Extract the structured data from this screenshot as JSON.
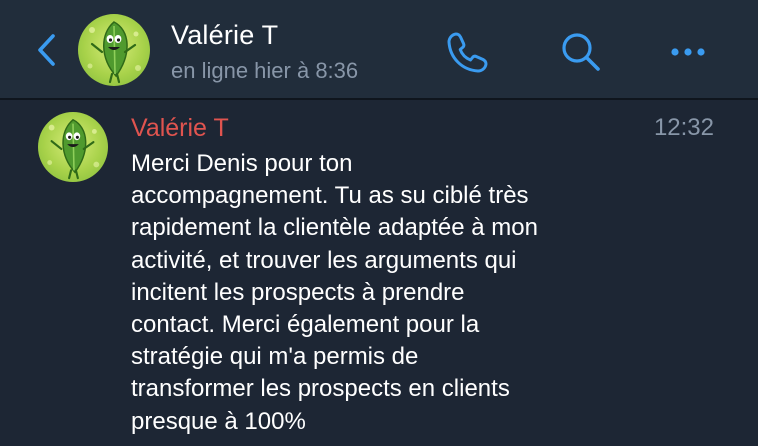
{
  "header": {
    "back_icon": "chevron-left-icon",
    "contact_name": "Valérie T",
    "status": "en ligne hier à 8:36",
    "actions": [
      "phone-icon",
      "search-icon",
      "more-icon"
    ]
  },
  "message": {
    "sender": "Valérie T",
    "time": "12:32",
    "lines": [
      "Merci Denis pour ton",
      "accompagnement. Tu as su ciblé très",
      "rapidement la clientèle adaptée à mon",
      "activité, et trouver les arguments qui",
      "incitent les prospects à prendre",
      "contact. Merci également pour la",
      "stratégie qui m'a permis de",
      "transformer les prospects en clients",
      "presque à 100%"
    ]
  },
  "colors": {
    "background": "#1d2634",
    "header_bg": "#212d3b",
    "accent": "#3a9bf0",
    "sender_name": "#e0544f",
    "secondary_text": "#8896a8",
    "text": "#ffffff"
  }
}
